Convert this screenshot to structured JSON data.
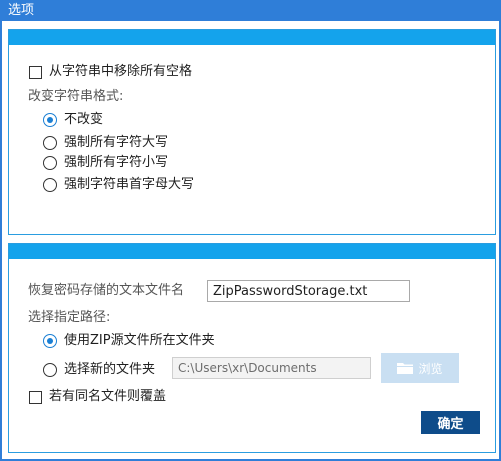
{
  "window": {
    "title": "选项"
  },
  "panel1": {
    "remove_spaces_label": "从字符串中移除所有空格",
    "format_heading": "改变字符串格式:",
    "options": [
      {
        "label": "不改变",
        "checked": true
      },
      {
        "label": "强制所有字符大写",
        "checked": false
      },
      {
        "label": "强制所有字符小写",
        "checked": false
      },
      {
        "label": "强制字符串首字母大写",
        "checked": false
      }
    ]
  },
  "panel2": {
    "filename_label": "恢复密码存储的文本文件名",
    "filename_value": "ZipPasswordStorage.txt",
    "path_heading": "选择指定路径:",
    "path_options": [
      {
        "label": "使用ZIP源文件所在文件夹",
        "checked": true
      },
      {
        "label": "选择新的文件夹",
        "checked": false
      }
    ],
    "folder_value": "C:\\Users\\xr\\Documents",
    "browse_label": "浏览",
    "overwrite_label": "若有同名文件则覆盖"
  },
  "ok_label": "确定",
  "colors": {
    "titlebar": "#2f7ed8",
    "panel_band": "#14a3ec",
    "radio_accent": "#1a7fd4",
    "browse_disabled": "#c9dff2",
    "ok_button": "#0e4c8a"
  }
}
